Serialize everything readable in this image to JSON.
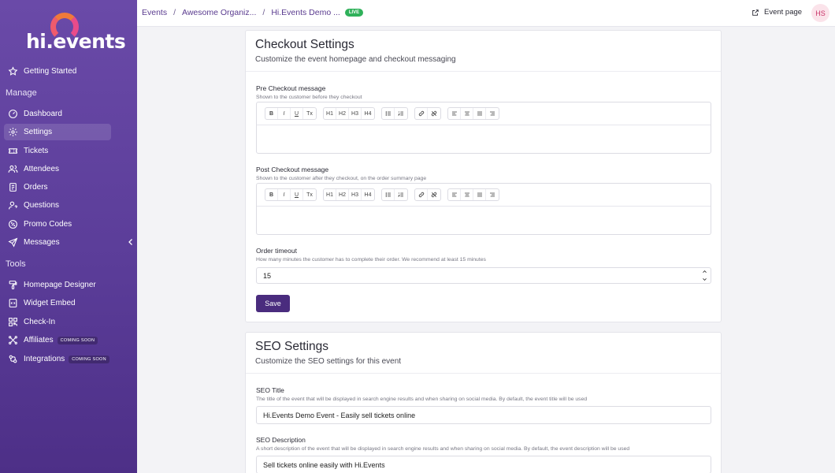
{
  "brand": {
    "logo_text": "hi.events"
  },
  "sidebar": {
    "top_item": {
      "label": "Getting Started",
      "icon": "star-icon"
    },
    "manage_heading": "Manage",
    "manage_items": [
      {
        "label": "Dashboard",
        "icon": "dashboard-icon"
      },
      {
        "label": "Settings",
        "icon": "gear-icon",
        "active": true
      },
      {
        "label": "Tickets",
        "icon": "ticket-icon"
      },
      {
        "label": "Attendees",
        "icon": "users-icon"
      },
      {
        "label": "Orders",
        "icon": "orders-icon"
      },
      {
        "label": "Questions",
        "icon": "question-user-icon"
      },
      {
        "label": "Promo Codes",
        "icon": "discount-icon"
      },
      {
        "label": "Messages",
        "icon": "send-icon"
      }
    ],
    "tools_heading": "Tools",
    "tools_items": [
      {
        "label": "Homepage Designer",
        "icon": "paint-roller-icon"
      },
      {
        "label": "Widget Embed",
        "icon": "code-icon"
      },
      {
        "label": "Check-In",
        "icon": "qr-icon"
      },
      {
        "label": "Affiliates",
        "icon": "affiliate-icon",
        "badge": "COMING SOON"
      },
      {
        "label": "Integrations",
        "icon": "integrations-icon",
        "badge": "COMING SOON"
      }
    ]
  },
  "topbar": {
    "breadcrumbs": [
      "Events",
      "Awesome Organiz...",
      "Hi.Events Demo ..."
    ],
    "separator": "/",
    "live_badge": "LIVE",
    "event_page_label": "Event page",
    "avatar_initials": "HS"
  },
  "checkout": {
    "title": "Checkout Settings",
    "subtitle": "Customize the event homepage and checkout messaging",
    "pre_label": "Pre Checkout message",
    "pre_hint": "Shown to the customer before they checkout",
    "post_label": "Post Checkout message",
    "post_hint": "Shown to the customer after they checkout, on the order summary page",
    "timeout_label": "Order timeout",
    "timeout_hint": "How many minutes the customer has to complete their order. We recommend at least 15 minutes",
    "timeout_value": "15",
    "save_label": "Save"
  },
  "editor_toolbar": {
    "marks": [
      "B",
      "I",
      "U",
      "Tx"
    ],
    "headings": [
      "H1",
      "H2",
      "H3",
      "H4"
    ]
  },
  "seo": {
    "title": "SEO Settings",
    "subtitle": "Customize the SEO settings for this event",
    "seo_title_label": "SEO Title",
    "seo_title_hint": "The title of the event that will be displayed in search engine results and when sharing on social media. By default, the event title will be used",
    "seo_title_value": "Hi.Events Demo Event - Easily sell tickets online",
    "seo_desc_label": "SEO Description",
    "seo_desc_hint": "A short description of the event that will be displayed in search engine results and when sharing on social media. By default, the event description will be used",
    "seo_desc_value": "Sell tickets online easily with Hi.Events"
  }
}
